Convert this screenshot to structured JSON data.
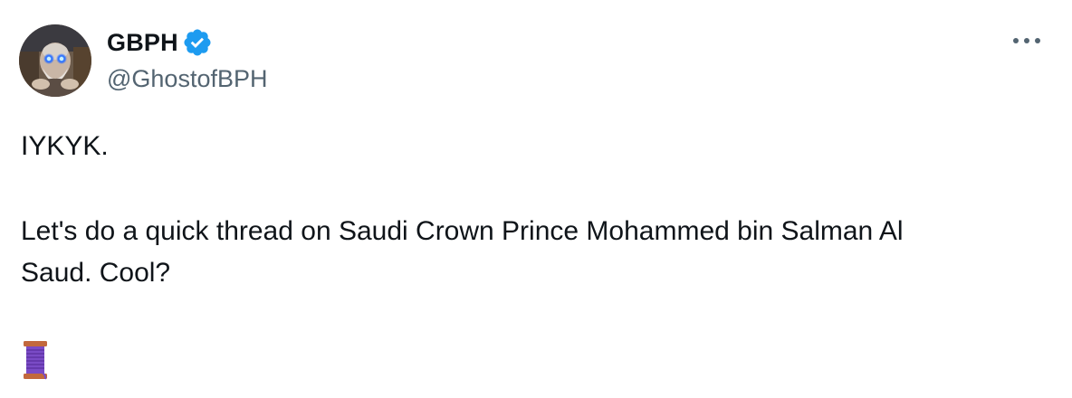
{
  "author": {
    "display_name": "GBPH",
    "handle": "@GhostofBPH",
    "verified": true
  },
  "tweet": {
    "line1": "IYKYK.",
    "line2": "Let's do a quick thread on Saudi Crown Prince Mohammed bin Salman Al",
    "line3": "Saud. Cool?",
    "emoji": "🧵"
  },
  "icons": {
    "verified": "verified-badge-icon",
    "more": "more-options-icon",
    "emoji": "thread-spool-icon"
  },
  "colors": {
    "text_primary": "#0f1419",
    "text_secondary": "#536471",
    "verified_blue": "#1d9bf0",
    "spool_purple": "#7a4bc6",
    "spool_wood": "#c2683d"
  }
}
